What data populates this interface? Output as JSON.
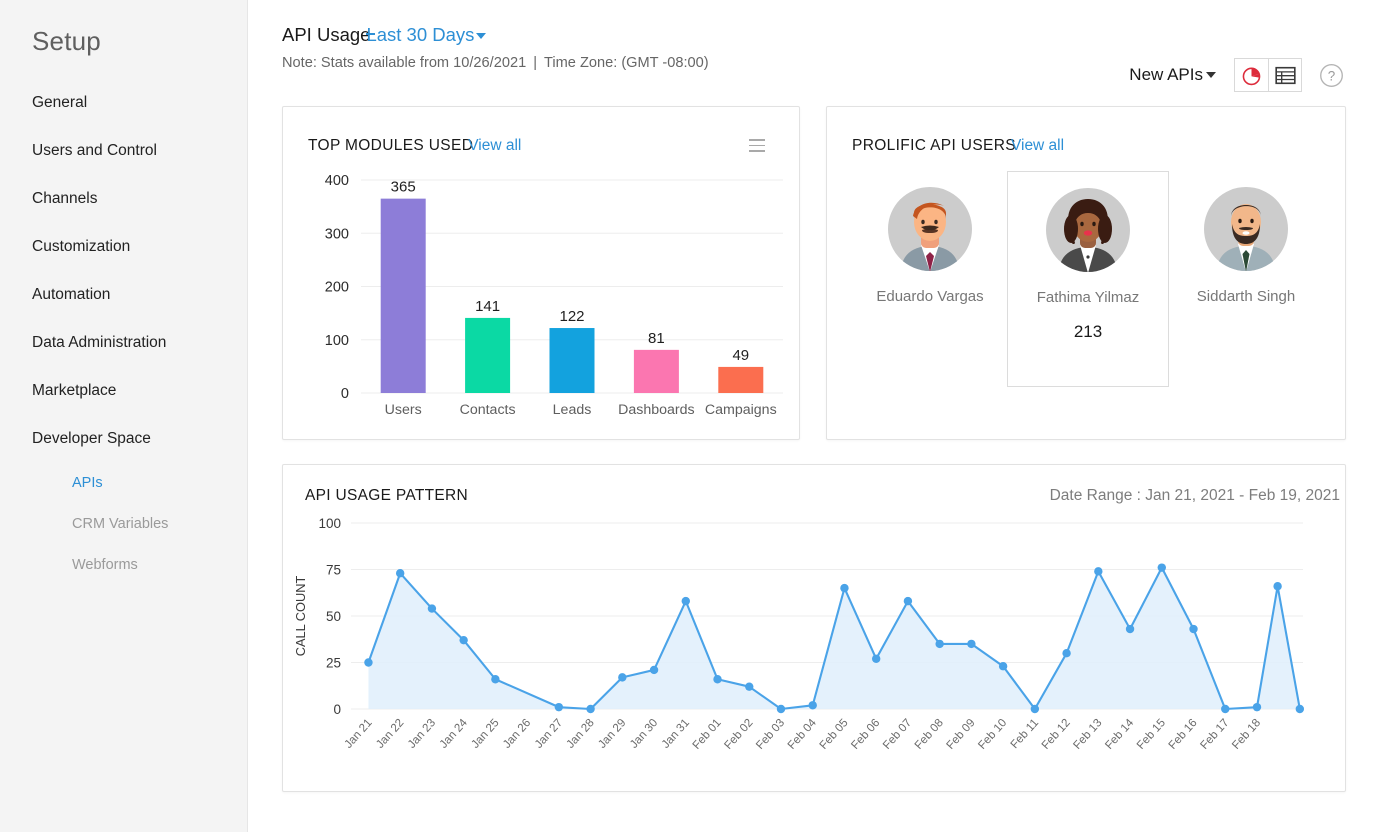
{
  "sidebar": {
    "title": "Setup",
    "items": [
      {
        "label": "General"
      },
      {
        "label": "Users and Control"
      },
      {
        "label": "Channels"
      },
      {
        "label": "Customization"
      },
      {
        "label": "Automation"
      },
      {
        "label": "Data Administration"
      },
      {
        "label": "Marketplace"
      },
      {
        "label": "Developer Space"
      }
    ],
    "sub_items": [
      {
        "label": "APIs",
        "active": true
      },
      {
        "label": "CRM Variables",
        "active": false
      },
      {
        "label": "Webforms",
        "active": false
      }
    ]
  },
  "header": {
    "title": "API Usage",
    "range_label": "Last 30 Days",
    "note_prefix": "Note: Stats available from 10/26/2021",
    "note_sep": "|",
    "timezone": "Time Zone: (GMT -08:00)",
    "new_apis_label": "New APIs",
    "pie_icon": "pie-chart-icon",
    "table_icon": "table-view-icon",
    "help_icon": "help-icon",
    "accent_blue": "#2d8fd5",
    "pie_red": "#dd2c3c"
  },
  "modules_card": {
    "title": "TOP MODULES USED",
    "view_all": "View all",
    "menu_icon": "hamburger-menu-icon"
  },
  "users_card": {
    "title": "PROLIFIC API USERS",
    "view_all": "View all",
    "users": [
      {
        "name": "Eduardo Vargas",
        "count": "",
        "highlight": false,
        "avatar": "avatar-eduardo-vargas"
      },
      {
        "name": "Fathima Yilmaz",
        "count": "213",
        "highlight": true,
        "avatar": "avatar-fathima-yilmaz"
      },
      {
        "name": "Siddarth Singh",
        "count": "",
        "highlight": false,
        "avatar": "avatar-siddarth-singh"
      }
    ]
  },
  "pattern_card": {
    "title": "API USAGE PATTERN",
    "date_range": "Date Range : Jan 21, 2021 - Feb 19, 2021"
  },
  "chart_data": [
    {
      "type": "bar",
      "title": "TOP MODULES USED",
      "categories": [
        "Users",
        "Contacts",
        "Leads",
        "Dashboards",
        "Campaigns"
      ],
      "values": [
        365,
        141,
        122,
        81,
        49
      ],
      "colors": [
        "#8d7dd8",
        "#0bd9a4",
        "#13a2de",
        "#fb76b0",
        "#fb6e4f"
      ],
      "xlabel": "",
      "ylabel": "",
      "ylim": [
        0,
        400
      ],
      "yticks": [
        0,
        100,
        200,
        300,
        400
      ],
      "grid": true,
      "data_labels": true,
      "legend": "none"
    },
    {
      "type": "area",
      "title": "API USAGE PATTERN",
      "xlabel": "",
      "ylabel": "CALL COUNT",
      "ylim": [
        0,
        100
      ],
      "yticks": [
        0,
        25,
        50,
        75,
        100
      ],
      "grid": true,
      "legend": "none",
      "line_color": "#4aa3e8",
      "fill_color": "#dfeefb",
      "categories": [
        "Jan 21",
        "Jan 22",
        "Jan 23",
        "Jan 24",
        "Jan 25",
        "Jan 26",
        "Jan 27",
        "Jan 28",
        "Jan 29",
        "Jan 30",
        "Jan 31",
        "Feb 01",
        "Feb 02",
        "Feb 03",
        "Feb 04",
        "Feb 05",
        "Feb 06",
        "Feb 07",
        "Feb 08",
        "Feb 09",
        "Feb 10",
        "Feb 11",
        "Feb 12",
        "Feb 13",
        "Feb 14",
        "Feb 15",
        "Feb 16",
        "Feb 17",
        "Feb 18"
      ],
      "values": [
        25,
        73,
        54,
        37,
        16,
        null,
        1,
        0,
        17,
        21,
        58,
        16,
        12,
        0,
        2,
        65,
        27,
        58,
        35,
        35,
        23,
        0,
        30,
        74,
        43,
        76,
        43,
        0,
        1
      ],
      "tail_value": 66,
      "final_zero_value": 0
    }
  ]
}
